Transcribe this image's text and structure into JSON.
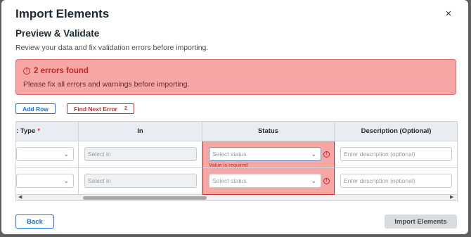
{
  "modal": {
    "title": "Import Elements",
    "close_icon": "×"
  },
  "section": {
    "title": "Preview & Validate",
    "subtitle": "Review your data and fix validation errors before importing."
  },
  "error_banner": {
    "icon": "!",
    "title": "2 errors found",
    "message": "Please fix all errors and warnings before importing."
  },
  "actions": {
    "add_row": "Add Row",
    "find_next_error": "Find Next Error",
    "error_count": "2"
  },
  "table": {
    "headers": {
      "type": ": Type",
      "type_required": "*",
      "in": "In",
      "status": "Status",
      "description": "Description (Optional)"
    },
    "rows": [
      {
        "in_placeholder": "Select in",
        "status_placeholder": "Select status",
        "status_error": "Value is required",
        "description_placeholder": "Enter description (optional)"
      },
      {
        "in_placeholder": "Select in",
        "status_placeholder": "Select status",
        "description_placeholder": "Enter description (optional)"
      }
    ],
    "scroll_left": "◀",
    "scroll_right": "▶"
  },
  "footer": {
    "back": "Back",
    "import": "Import Elements"
  },
  "colors": {
    "accent": "#1a73e8",
    "error": "#c62828",
    "error_bg": "#f7a6a6"
  }
}
